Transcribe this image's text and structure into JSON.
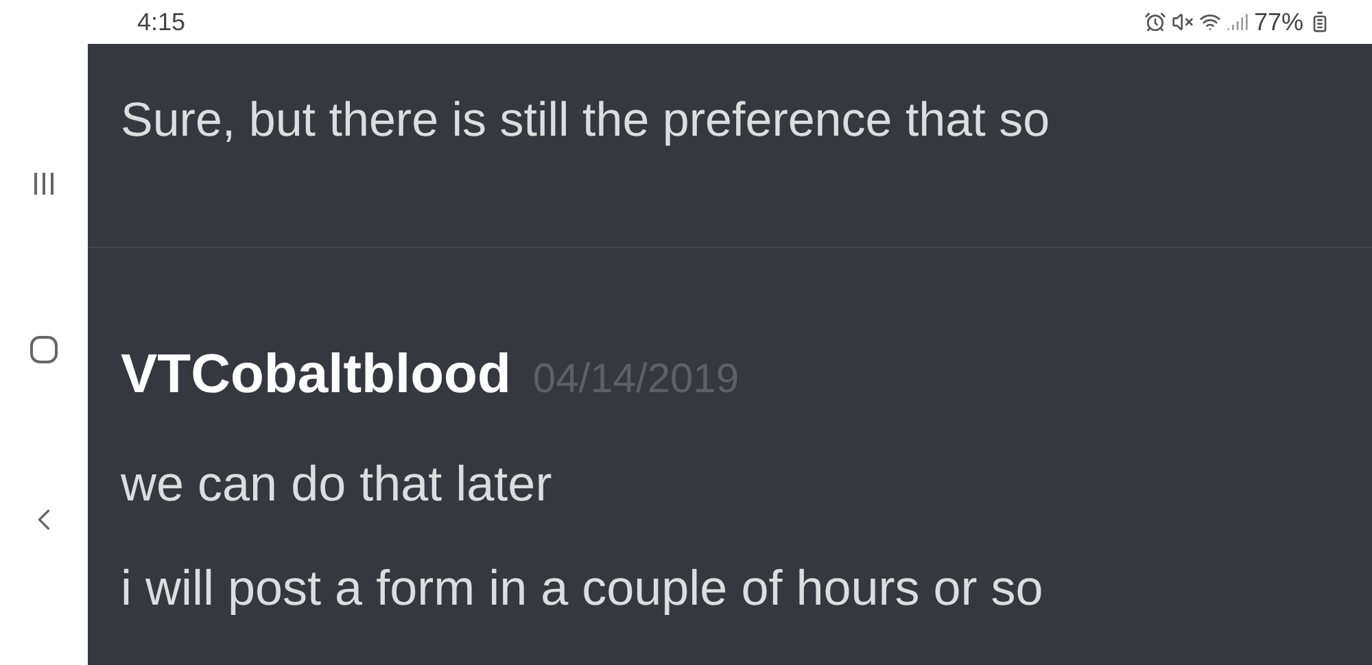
{
  "status_bar": {
    "time": "4:15",
    "battery": "77%"
  },
  "messages": [
    {
      "kind": "continuation",
      "lines": [
        "Sure, but there is still the preference that so"
      ]
    },
    {
      "kind": "header",
      "author": "VTCobaltblood",
      "date": "04/14/2019",
      "lines": [
        "we can do that later",
        "i will post a form in a couple of hours or so"
      ]
    }
  ]
}
